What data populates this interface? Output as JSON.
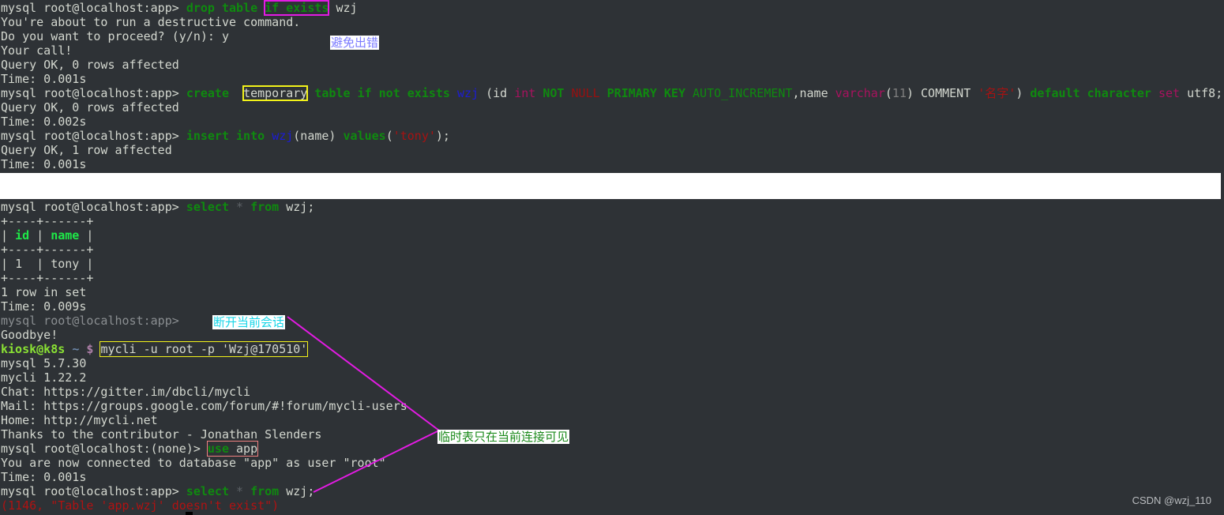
{
  "terminal": {
    "prompt_app": "mysql root@localhost:app> ",
    "prompt_none": "mysql root@localhost:(none)> ",
    "drop_cmd": {
      "kw1": "drop table",
      "highlight": "if exists",
      "rest": " wzj"
    },
    "destructive_warning": "You're about to run a destructive command.",
    "proceed_question": "Do you want to proceed? (y/n): y",
    "your_call": "Your call!",
    "query_ok_0_rows": "Query OK, 0 rows affected",
    "time_1": "Time: 0.001s",
    "create_cmd": {
      "create": "create",
      "temporary": "temporary",
      "table_if_not_exists": "table if not exists",
      "table_name": "wzj",
      "open": " (id ",
      "int": "int",
      "not": "NOT",
      "null": "NULL",
      "primary_key": "PRIMARY KEY",
      "auto_increment": "AUTO_INCREMENT",
      "name_col": ",name ",
      "varchar": "varchar",
      "paren_open": "(",
      "len": "11",
      "comment_kw": ") COMMENT ",
      "comment_str": "'名字'",
      "close": ") ",
      "default_charset": "default character",
      "set": "set",
      "charset_val": " utf8;"
    },
    "query_ok_0_rows_2": "Query OK, 0 rows affected",
    "time_2": "Time: 0.002s",
    "insert_cmd": {
      "insert_into": "insert into",
      "table_name": "wzj",
      "cols": "(name) ",
      "values": "values",
      "open": "(",
      "str": "'tony'",
      "close": ");"
    },
    "query_ok_1_row": "Query OK, 1 row affected",
    "time_3": "Time: 0.001s",
    "select_cmd": {
      "select": "select",
      "star": "*",
      "from": "from",
      "rest": " wzj;"
    },
    "table": {
      "border": "+----+------+",
      "headers": [
        "id",
        "name"
      ],
      "rows": [
        [
          "1 ",
          "tony"
        ]
      ]
    },
    "rows_in_set": "1 row in set",
    "time_4": "Time: 0.009s",
    "disconnect_prompt": "mysql root@localhost:app>",
    "goodbye": "Goodbye!",
    "shell_prompt": {
      "userhost": "kiosk@k8s",
      "tilde": "~",
      "dollar": "$"
    },
    "mycli_cmd": "mycli -u root -p 'Wzj@170510'",
    "mysql_version": "mysql 5.7.30",
    "mycli_version": "mycli 1.22.2",
    "chat": "Chat: https://gitter.im/dbcli/mycli",
    "mail": "Mail: https://groups.google.com/forum/#!forum/mycli-users",
    "home": "Home: http://mycli.net",
    "thanks": "Thanks to the contributor - Jonathan Slenders",
    "use_cmd": {
      "use": "use",
      "db": " app"
    },
    "connected": "You are now connected to database \"app\" as user \"root\"",
    "time_5": "Time: 0.001s",
    "error": "(1146, \"Table 'app.wzj' doesn't exist\")"
  },
  "annotations": {
    "note_avoid_error": "避免出错",
    "note_disconnect": "断开当前会话",
    "note_temp_visible": "临时表只在当前连接可见",
    "annotation_colors": {
      "magenta": "#e31be3",
      "yellow": "#f2f21a",
      "salmon": "#f08080"
    }
  },
  "watermark": "CSDN @wzj_110"
}
